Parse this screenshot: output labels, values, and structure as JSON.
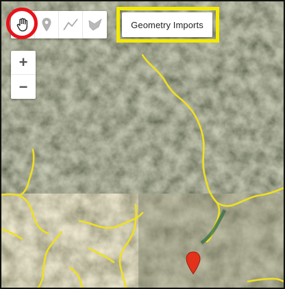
{
  "toolbar": {
    "tools": [
      {
        "name": "hand-pan-tool",
        "icon": "hand-icon",
        "active": true
      },
      {
        "name": "point-marker-tool",
        "icon": "marker-icon",
        "active": false
      },
      {
        "name": "line-draw-tool",
        "icon": "line-icon",
        "active": false
      },
      {
        "name": "polygon-draw-tool",
        "icon": "polygon-icon",
        "active": false
      }
    ]
  },
  "geometry_imports": {
    "label": "Geometry Imports"
  },
  "zoom": {
    "in_label": "+",
    "out_label": "−"
  },
  "colors": {
    "highlight_red": "#e8121a",
    "highlight_yellow": "#f4ea00",
    "river_yellow": "#f0e020",
    "marker_red": "#e2321b"
  }
}
